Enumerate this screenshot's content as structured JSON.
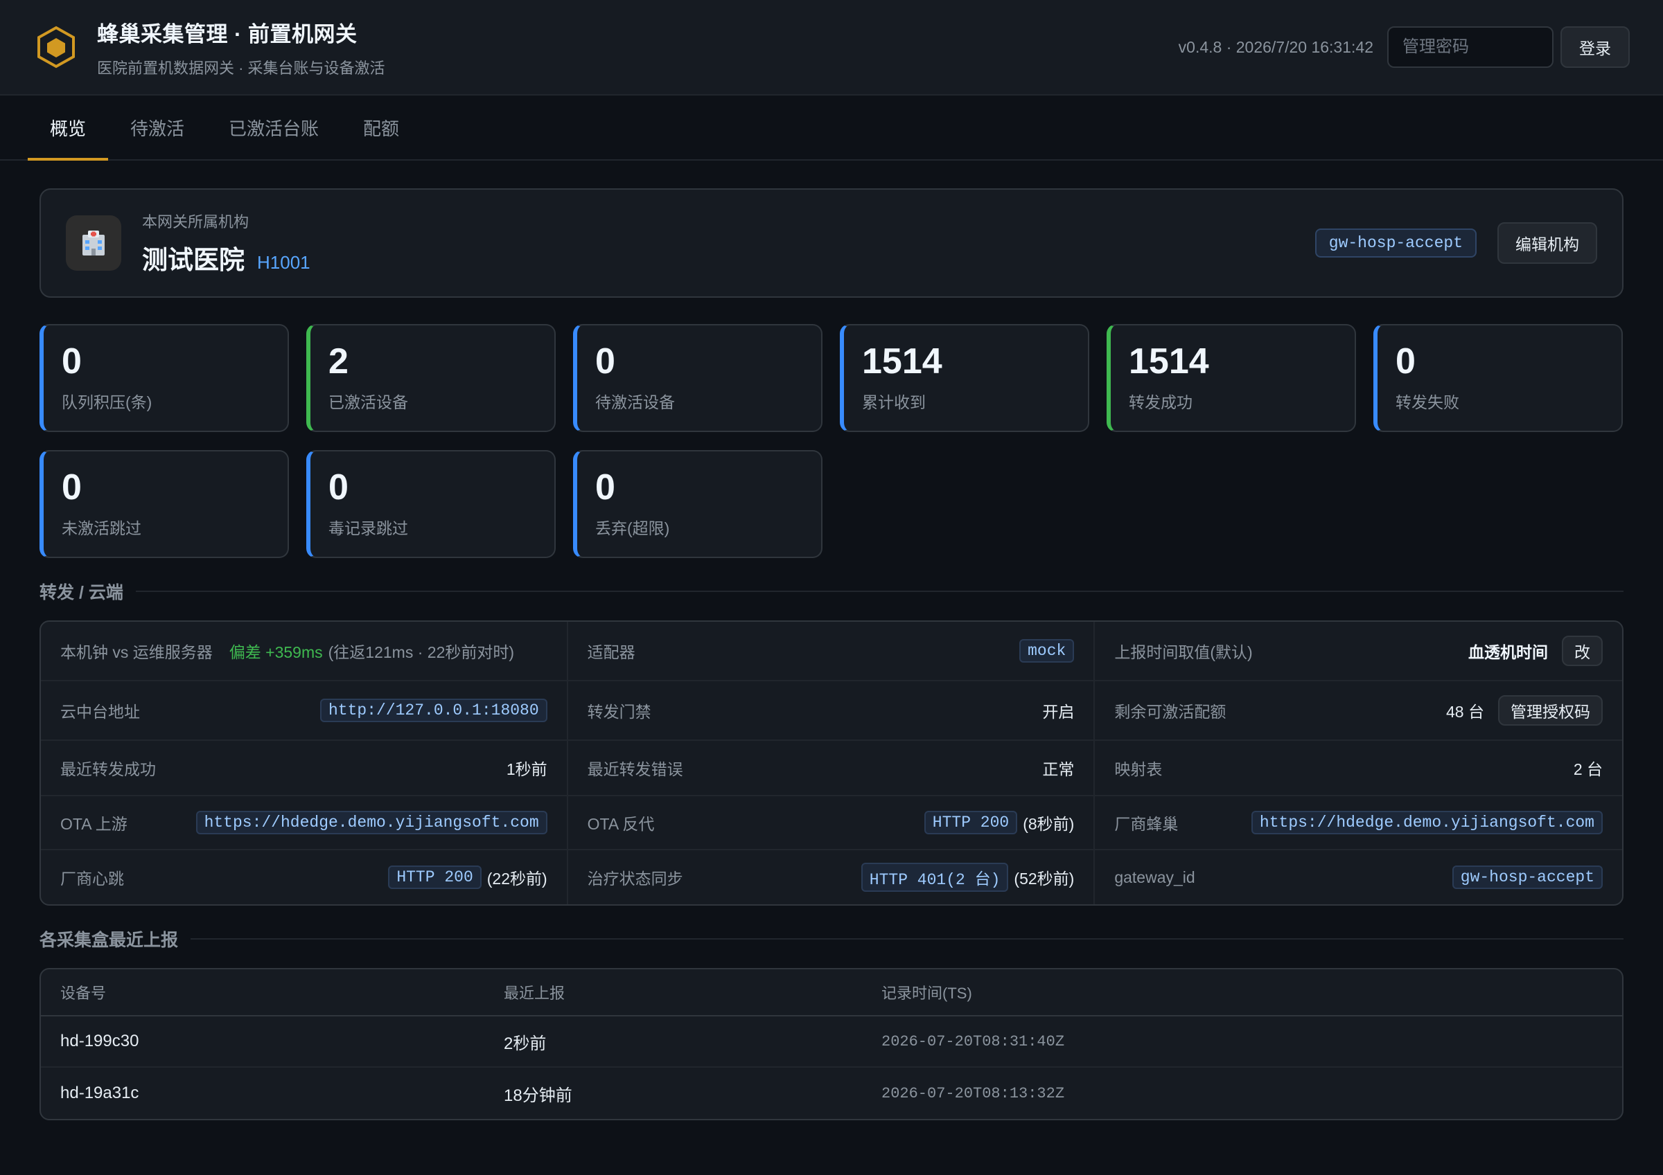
{
  "header": {
    "title": "蜂巢采集管理 · 前置机网关",
    "subtitle": "医院前置机数据网关 · 采集台账与设备激活",
    "version": "v0.4.8 · 2026/7/20 16:31:42",
    "password_placeholder": "管理密码",
    "login_label": "登录"
  },
  "tabs": [
    {
      "label": "概览",
      "active": true
    },
    {
      "label": "待激活",
      "active": false
    },
    {
      "label": "已激活台账",
      "active": false
    },
    {
      "label": "配额",
      "active": false
    }
  ],
  "org": {
    "label": "本网关所属机构",
    "name": "测试医院",
    "code": "H1001",
    "gateway": "gw-hosp-accept",
    "edit_label": "编辑机构",
    "icon": "hospital-icon"
  },
  "stats": [
    {
      "value": "0",
      "label": "队列积压(条)",
      "accent": "#388bfd"
    },
    {
      "value": "2",
      "label": "已激活设备",
      "accent": "#3fb950"
    },
    {
      "value": "0",
      "label": "待激活设备",
      "accent": "#388bfd"
    },
    {
      "value": "1514",
      "label": "累计收到",
      "accent": "#388bfd"
    },
    {
      "value": "1514",
      "label": "转发成功",
      "accent": "#3fb950"
    },
    {
      "value": "0",
      "label": "转发失败",
      "accent": "#388bfd"
    },
    {
      "value": "0",
      "label": "未激活跳过",
      "accent": "#388bfd"
    },
    {
      "value": "0",
      "label": "毒记录跳过",
      "accent": "#388bfd"
    },
    {
      "value": "0",
      "label": "丢弃(超限)",
      "accent": "#388bfd"
    }
  ],
  "forward": {
    "section_title": "转发 / 云端",
    "clock": {
      "label": "本机钟 vs 运维服务器",
      "offset": "偏差 +359ms",
      "detail": "(往返121ms · 22秒前对时)"
    },
    "adapter": {
      "label": "适配器",
      "value": "mock"
    },
    "report_time": {
      "label": "上报时间取值(默认)",
      "value": "血透机时间",
      "btn": "改"
    },
    "cloud_addr": {
      "label": "云中台地址",
      "value": "http://127.0.0.1:18080"
    },
    "gate": {
      "label": "转发门禁",
      "value": "开启"
    },
    "quota": {
      "label": "剩余可激活配额",
      "value": "48 台",
      "btn": "管理授权码"
    },
    "last_ok": {
      "label": "最近转发成功",
      "value": "1秒前"
    },
    "last_err": {
      "label": "最近转发错误",
      "value": "正常"
    },
    "mapping": {
      "label": "映射表",
      "value": "2 台"
    },
    "ota_up": {
      "label": "OTA 上游",
      "value": "https://hdedge.demo.yijiangsoft.com"
    },
    "ota_proxy": {
      "label": "OTA 反代",
      "code": "HTTP 200",
      "ago": "(8秒前)"
    },
    "vendor_hive": {
      "label": "厂商蜂巢",
      "value": "https://hdedge.demo.yijiangsoft.com"
    },
    "vendor_hb": {
      "label": "厂商心跳",
      "code": "HTTP 200",
      "ago": "(22秒前)"
    },
    "treat_sync": {
      "label": "治疗状态同步",
      "code": "HTTP 401(2 台)",
      "ago": "(52秒前)"
    },
    "gateway_id": {
      "label": "gateway_id",
      "value": "gw-hosp-accept"
    }
  },
  "boxes": {
    "section_title": "各采集盒最近上报",
    "columns": [
      "设备号",
      "最近上报",
      "记录时间(TS)"
    ],
    "rows": [
      {
        "device": "hd-199c30",
        "last": "2秒前",
        "ts": "2026-07-20T08:31:40Z"
      },
      {
        "device": "hd-19a31c",
        "last": "18分钟前",
        "ts": "2026-07-20T08:13:32Z"
      }
    ]
  }
}
